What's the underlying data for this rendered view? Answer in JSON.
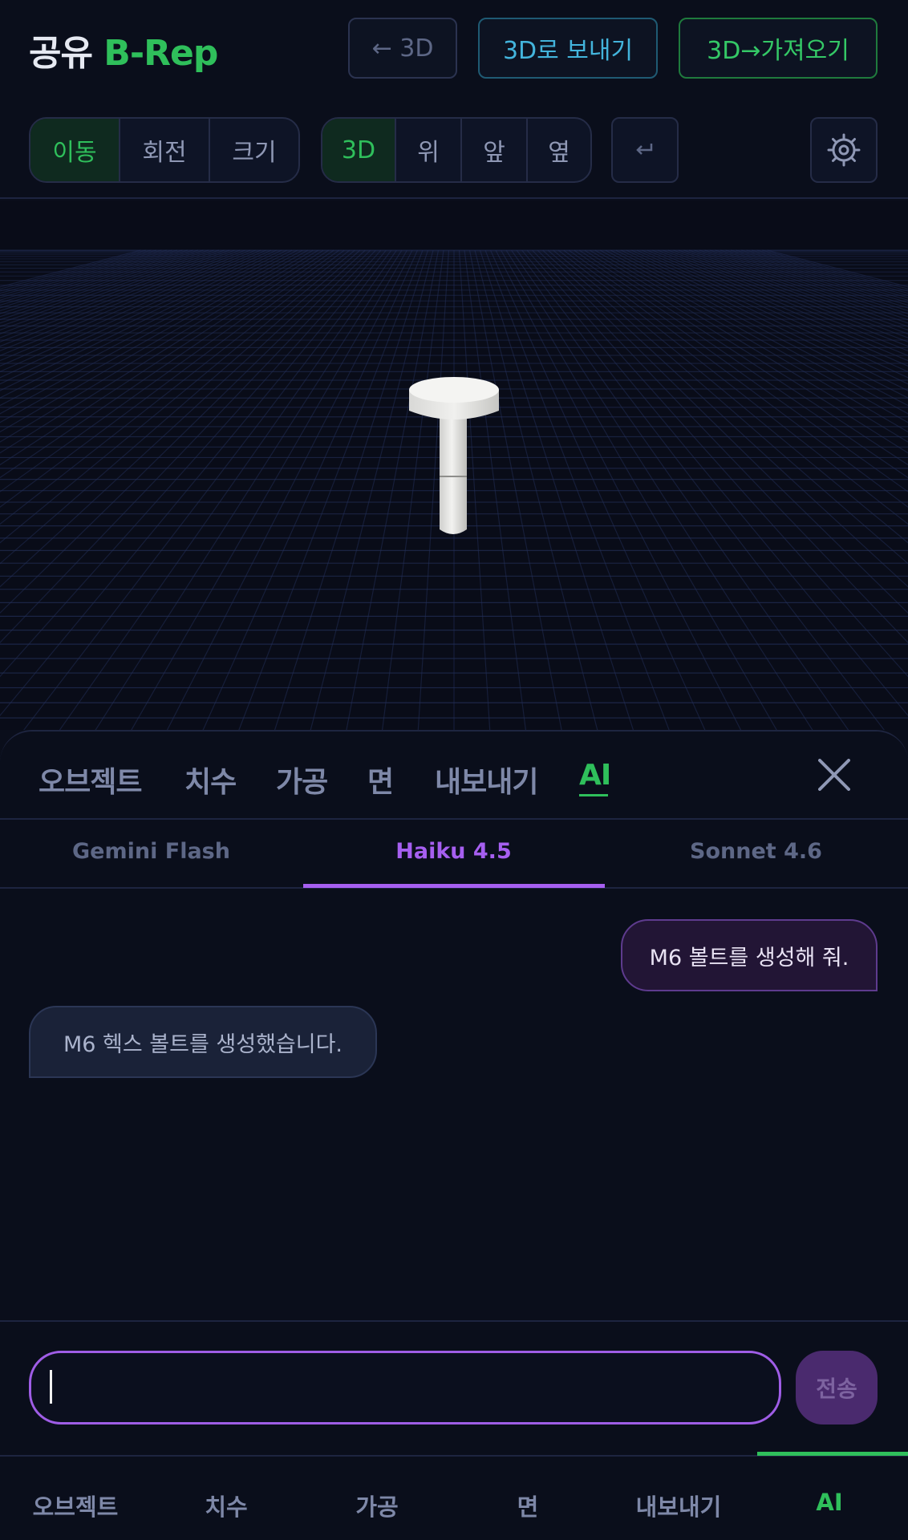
{
  "header": {
    "brand_prefix": "공유",
    "brand_accent": "B-Rep",
    "back_label": "← 3D",
    "send_label": "3D로 보내기",
    "import_label": "3D→가져오기"
  },
  "toolbar": {
    "transform_modes": [
      "이동",
      "회전",
      "크기"
    ],
    "views": [
      "3D",
      "위",
      "앞",
      "옆"
    ],
    "undo_icon": "return-arrow-icon",
    "settings_icon": "gear-icon"
  },
  "panel": {
    "tabs": [
      "오브젝트",
      "치수",
      "가공",
      "면",
      "내보내기",
      "AI"
    ],
    "active_tab": "AI",
    "close_icon": "close-icon"
  },
  "ai": {
    "models": [
      "Gemini Flash",
      "Haiku 4.5",
      "Sonnet 4.6"
    ],
    "active_model": "Haiku 4.5",
    "messages": [
      {
        "role": "user",
        "text": "M6 볼트를 생성해 줘."
      },
      {
        "role": "assistant",
        "text": "M6 헥스 볼트를 생성했습니다."
      }
    ],
    "input_value": "",
    "send_label": "전송"
  },
  "bottom_nav": {
    "items": [
      "오브젝트",
      "치수",
      "가공",
      "면",
      "내보내기",
      "AI"
    ],
    "active": "AI"
  },
  "colors": {
    "background": "#0a0e1b",
    "accent_green": "#2fbf5b",
    "accent_purple": "#a65ff0",
    "accent_blue": "#43b4dc"
  }
}
